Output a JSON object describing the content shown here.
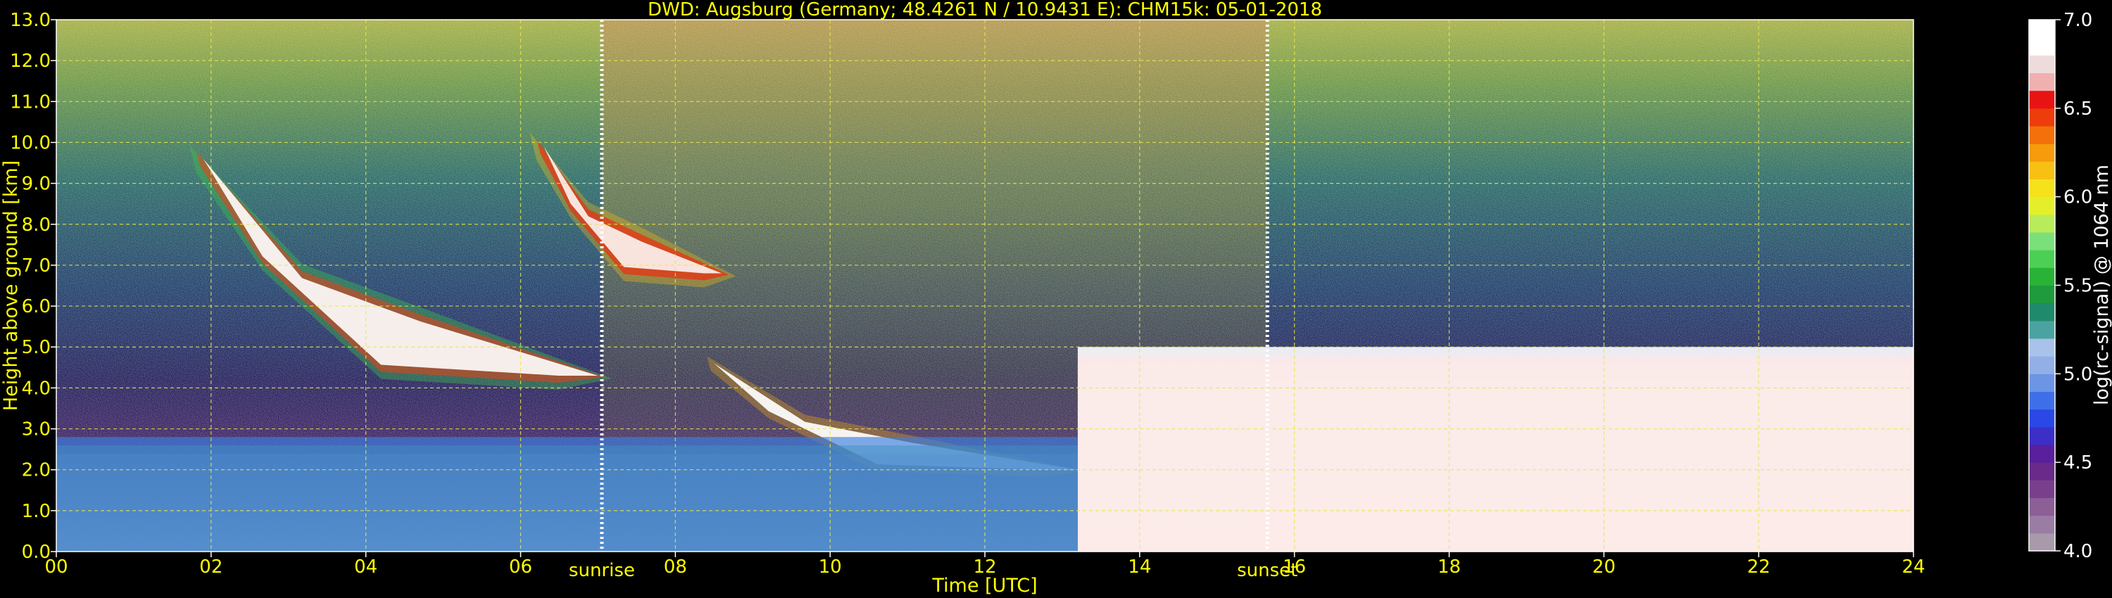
{
  "chart_data": {
    "type": "heatmap",
    "title": "DWD: Augsburg (Germany; 48.4261 N / 10.9431 E):    CHM15k: 05-01-2018",
    "xlabel": "Time [UTC]",
    "ylabel": "Height above ground [km]",
    "xlim": [
      0,
      24
    ],
    "ylim": [
      0,
      13
    ],
    "x_ticks": [
      "00",
      "02",
      "04",
      "06",
      "08",
      "10",
      "12",
      "14",
      "16",
      "18",
      "20",
      "22",
      "24"
    ],
    "y_ticks": [
      "0.0",
      "1.0",
      "2.0",
      "3.0",
      "4.0",
      "5.0",
      "6.0",
      "7.0",
      "8.0",
      "9.0",
      "10.0",
      "11.0",
      "12.0",
      "13.0"
    ],
    "grid": true,
    "markers": [
      {
        "label": "sunrise",
        "x": 7.05
      },
      {
        "label": "sunset",
        "x": 15.65
      }
    ],
    "colorbar": {
      "label": "log(rc-signal) @ 1064 nm",
      "range": [
        4.0,
        7.0
      ],
      "ticks": [
        "4.0",
        "4.5",
        "5.0",
        "5.5",
        "6.0",
        "6.5",
        "7.0"
      ],
      "colors": [
        "#a89aab",
        "#9a7da4",
        "#8c5f97",
        "#7a3f8c",
        "#6a2a8a",
        "#5a1f9c",
        "#3b2fc8",
        "#2a48e6",
        "#3f6fe8",
        "#6c95e6",
        "#92b0e6",
        "#a9c2ea",
        "#4aa3a0",
        "#1f8a6c",
        "#1f9a3c",
        "#28b238",
        "#4ccf55",
        "#7be07a",
        "#b8ec5a",
        "#e4ef2a",
        "#f5e21a",
        "#f7c012",
        "#f79a0c",
        "#f3700a",
        "#ee3c0c",
        "#e81414",
        "#f0b0b0",
        "#eedcdc",
        "#ffffff",
        "#ffffff"
      ]
    },
    "features": [
      {
        "name": "cirrus-layer",
        "x": [
          1.9,
          7.0
        ],
        "y": [
          4.3,
          9.6
        ]
      },
      {
        "name": "upper-cirrus",
        "x": [
          6.3,
          8.6
        ],
        "y": [
          6.8,
          9.9
        ]
      },
      {
        "name": "midlevel-cloud",
        "x": [
          8.5,
          13.2
        ],
        "y": [
          2.0,
          4.6
        ]
      },
      {
        "name": "low-cloud",
        "x": [
          13.2,
          24.0
        ],
        "y": [
          0.0,
          5.0
        ]
      },
      {
        "name": "boundary-layer",
        "x": [
          0.0,
          13.2
        ],
        "y": [
          0.0,
          2.8
        ]
      }
    ],
    "text_color": "#ffff00",
    "background": "#000000"
  }
}
